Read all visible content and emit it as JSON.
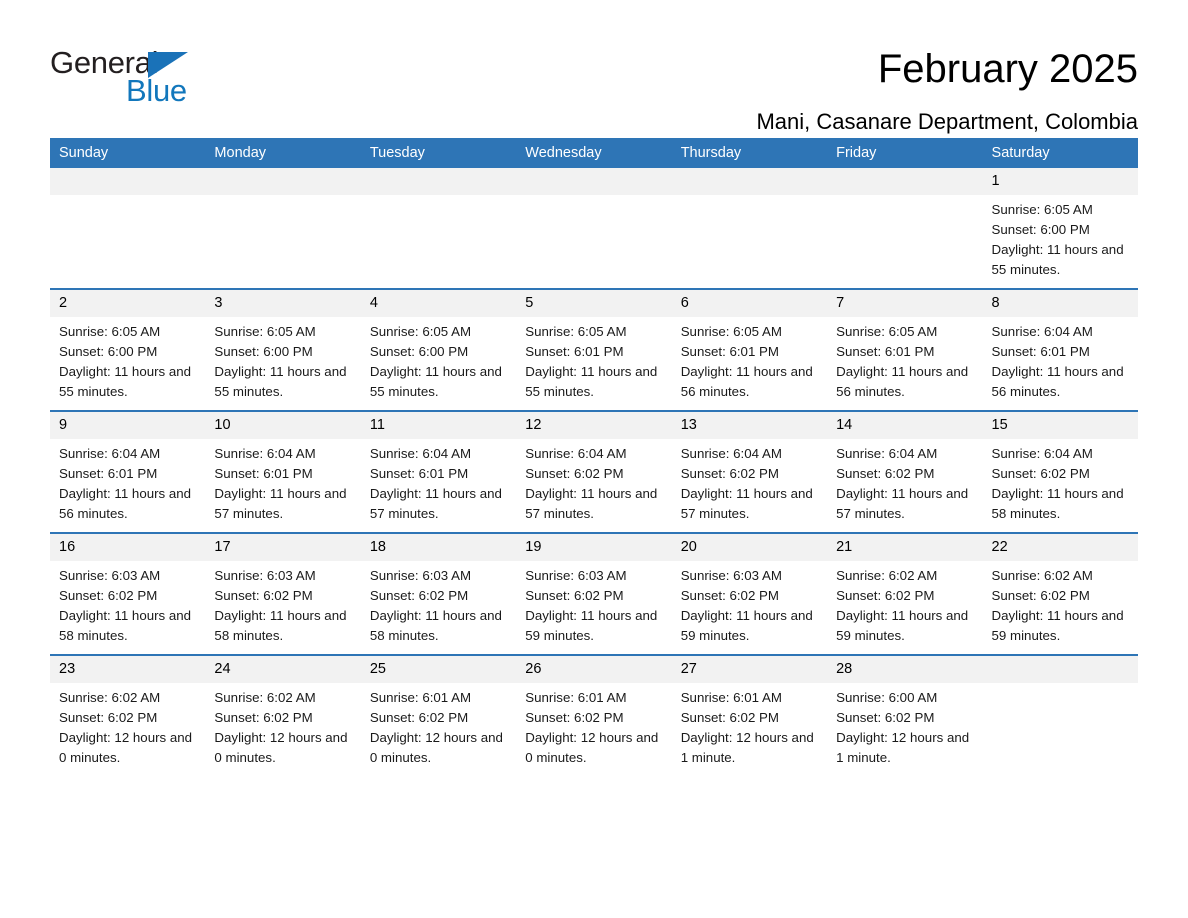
{
  "brand": {
    "name_part1": "General",
    "name_part2": "Blue",
    "accent_color": "#1a72b8"
  },
  "header": {
    "month_title": "February 2025",
    "location": "Mani, Casanare Department, Colombia"
  },
  "calendar": {
    "header_background": "#2e75b6",
    "daynum_background": "#f2f2f2",
    "weekday_headers": [
      "Sunday",
      "Monday",
      "Tuesday",
      "Wednesday",
      "Thursday",
      "Friday",
      "Saturday"
    ],
    "weeks": [
      [
        {
          "day": "",
          "sunrise": "",
          "sunset": "",
          "daylight": "",
          "empty": true
        },
        {
          "day": "",
          "sunrise": "",
          "sunset": "",
          "daylight": "",
          "empty": true
        },
        {
          "day": "",
          "sunrise": "",
          "sunset": "",
          "daylight": "",
          "empty": true
        },
        {
          "day": "",
          "sunrise": "",
          "sunset": "",
          "daylight": "",
          "empty": true
        },
        {
          "day": "",
          "sunrise": "",
          "sunset": "",
          "daylight": "",
          "empty": true
        },
        {
          "day": "",
          "sunrise": "",
          "sunset": "",
          "daylight": "",
          "empty": true
        },
        {
          "day": "1",
          "sunrise": "Sunrise: 6:05 AM",
          "sunset": "Sunset: 6:00 PM",
          "daylight": "Daylight: 11 hours and 55 minutes.",
          "empty": false
        }
      ],
      [
        {
          "day": "2",
          "sunrise": "Sunrise: 6:05 AM",
          "sunset": "Sunset: 6:00 PM",
          "daylight": "Daylight: 11 hours and 55 minutes.",
          "empty": false
        },
        {
          "day": "3",
          "sunrise": "Sunrise: 6:05 AM",
          "sunset": "Sunset: 6:00 PM",
          "daylight": "Daylight: 11 hours and 55 minutes.",
          "empty": false
        },
        {
          "day": "4",
          "sunrise": "Sunrise: 6:05 AM",
          "sunset": "Sunset: 6:00 PM",
          "daylight": "Daylight: 11 hours and 55 minutes.",
          "empty": false
        },
        {
          "day": "5",
          "sunrise": "Sunrise: 6:05 AM",
          "sunset": "Sunset: 6:01 PM",
          "daylight": "Daylight: 11 hours and 55 minutes.",
          "empty": false
        },
        {
          "day": "6",
          "sunrise": "Sunrise: 6:05 AM",
          "sunset": "Sunset: 6:01 PM",
          "daylight": "Daylight: 11 hours and 56 minutes.",
          "empty": false
        },
        {
          "day": "7",
          "sunrise": "Sunrise: 6:05 AM",
          "sunset": "Sunset: 6:01 PM",
          "daylight": "Daylight: 11 hours and 56 minutes.",
          "empty": false
        },
        {
          "day": "8",
          "sunrise": "Sunrise: 6:04 AM",
          "sunset": "Sunset: 6:01 PM",
          "daylight": "Daylight: 11 hours and 56 minutes.",
          "empty": false
        }
      ],
      [
        {
          "day": "9",
          "sunrise": "Sunrise: 6:04 AM",
          "sunset": "Sunset: 6:01 PM",
          "daylight": "Daylight: 11 hours and 56 minutes.",
          "empty": false
        },
        {
          "day": "10",
          "sunrise": "Sunrise: 6:04 AM",
          "sunset": "Sunset: 6:01 PM",
          "daylight": "Daylight: 11 hours and 57 minutes.",
          "empty": false
        },
        {
          "day": "11",
          "sunrise": "Sunrise: 6:04 AM",
          "sunset": "Sunset: 6:01 PM",
          "daylight": "Daylight: 11 hours and 57 minutes.",
          "empty": false
        },
        {
          "day": "12",
          "sunrise": "Sunrise: 6:04 AM",
          "sunset": "Sunset: 6:02 PM",
          "daylight": "Daylight: 11 hours and 57 minutes.",
          "empty": false
        },
        {
          "day": "13",
          "sunrise": "Sunrise: 6:04 AM",
          "sunset": "Sunset: 6:02 PM",
          "daylight": "Daylight: 11 hours and 57 minutes.",
          "empty": false
        },
        {
          "day": "14",
          "sunrise": "Sunrise: 6:04 AM",
          "sunset": "Sunset: 6:02 PM",
          "daylight": "Daylight: 11 hours and 57 minutes.",
          "empty": false
        },
        {
          "day": "15",
          "sunrise": "Sunrise: 6:04 AM",
          "sunset": "Sunset: 6:02 PM",
          "daylight": "Daylight: 11 hours and 58 minutes.",
          "empty": false
        }
      ],
      [
        {
          "day": "16",
          "sunrise": "Sunrise: 6:03 AM",
          "sunset": "Sunset: 6:02 PM",
          "daylight": "Daylight: 11 hours and 58 minutes.",
          "empty": false
        },
        {
          "day": "17",
          "sunrise": "Sunrise: 6:03 AM",
          "sunset": "Sunset: 6:02 PM",
          "daylight": "Daylight: 11 hours and 58 minutes.",
          "empty": false
        },
        {
          "day": "18",
          "sunrise": "Sunrise: 6:03 AM",
          "sunset": "Sunset: 6:02 PM",
          "daylight": "Daylight: 11 hours and 58 minutes.",
          "empty": false
        },
        {
          "day": "19",
          "sunrise": "Sunrise: 6:03 AM",
          "sunset": "Sunset: 6:02 PM",
          "daylight": "Daylight: 11 hours and 59 minutes.",
          "empty": false
        },
        {
          "day": "20",
          "sunrise": "Sunrise: 6:03 AM",
          "sunset": "Sunset: 6:02 PM",
          "daylight": "Daylight: 11 hours and 59 minutes.",
          "empty": false
        },
        {
          "day": "21",
          "sunrise": "Sunrise: 6:02 AM",
          "sunset": "Sunset: 6:02 PM",
          "daylight": "Daylight: 11 hours and 59 minutes.",
          "empty": false
        },
        {
          "day": "22",
          "sunrise": "Sunrise: 6:02 AM",
          "sunset": "Sunset: 6:02 PM",
          "daylight": "Daylight: 11 hours and 59 minutes.",
          "empty": false
        }
      ],
      [
        {
          "day": "23",
          "sunrise": "Sunrise: 6:02 AM",
          "sunset": "Sunset: 6:02 PM",
          "daylight": "Daylight: 12 hours and 0 minutes.",
          "empty": false
        },
        {
          "day": "24",
          "sunrise": "Sunrise: 6:02 AM",
          "sunset": "Sunset: 6:02 PM",
          "daylight": "Daylight: 12 hours and 0 minutes.",
          "empty": false
        },
        {
          "day": "25",
          "sunrise": "Sunrise: 6:01 AM",
          "sunset": "Sunset: 6:02 PM",
          "daylight": "Daylight: 12 hours and 0 minutes.",
          "empty": false
        },
        {
          "day": "26",
          "sunrise": "Sunrise: 6:01 AM",
          "sunset": "Sunset: 6:02 PM",
          "daylight": "Daylight: 12 hours and 0 minutes.",
          "empty": false
        },
        {
          "day": "27",
          "sunrise": "Sunrise: 6:01 AM",
          "sunset": "Sunset: 6:02 PM",
          "daylight": "Daylight: 12 hours and 1 minute.",
          "empty": false
        },
        {
          "day": "28",
          "sunrise": "Sunrise: 6:00 AM",
          "sunset": "Sunset: 6:02 PM",
          "daylight": "Daylight: 12 hours and 1 minute.",
          "empty": false
        },
        {
          "day": "",
          "sunrise": "",
          "sunset": "",
          "daylight": "",
          "empty": true
        }
      ]
    ]
  }
}
